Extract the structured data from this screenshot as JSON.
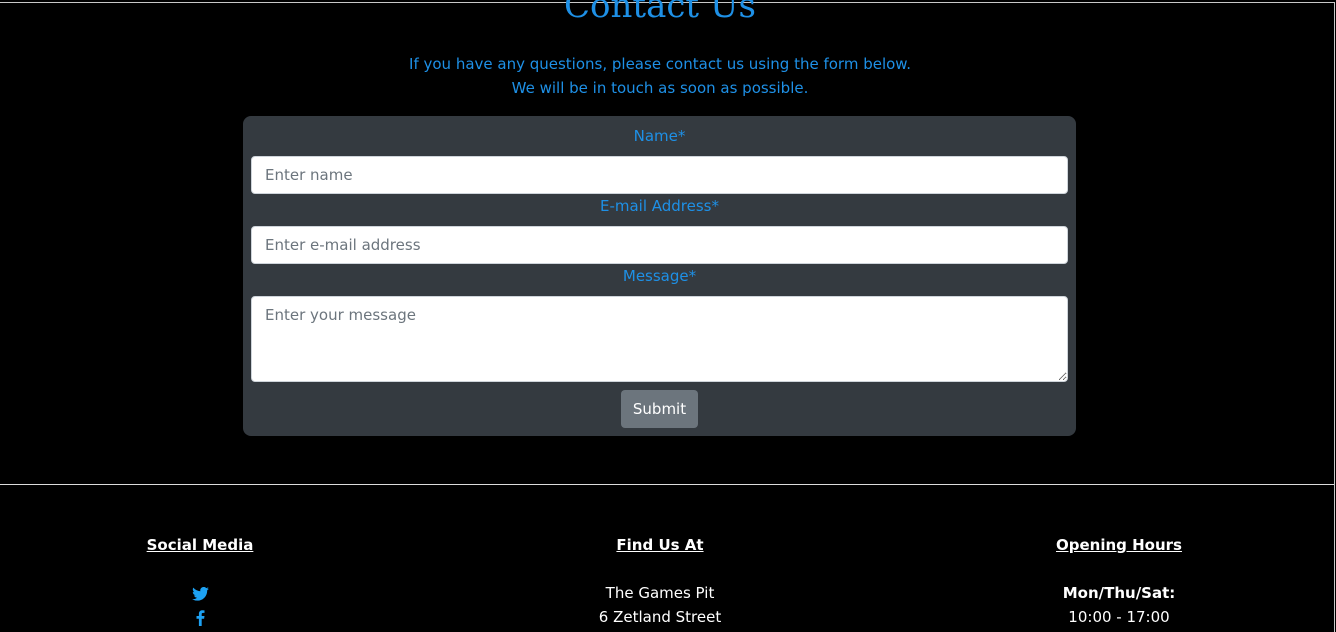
{
  "contact": {
    "title": "Contact Us",
    "intro_line1": "If you have any questions, please contact us using the form below.",
    "intro_line2": "We will be in touch as soon as possible."
  },
  "form": {
    "name_label": "Name*",
    "name_placeholder": "Enter name",
    "email_label": "E-mail Address*",
    "email_placeholder": "Enter e-mail address",
    "message_label": "Message*",
    "message_placeholder": "Enter your message",
    "submit_label": "Submit"
  },
  "footer": {
    "social": {
      "heading": "Social Media",
      "icons": [
        "twitter-icon",
        "facebook-icon"
      ]
    },
    "find_us": {
      "heading": "Find Us At",
      "line1": "The Games Pit",
      "line2": "6 Zetland Street"
    },
    "hours": {
      "heading": "Opening Hours",
      "days": "Mon/Thu/Sat:",
      "times": "10:00 - 17:00"
    }
  },
  "colors": {
    "accent": "#1e90e6",
    "card": "#343a40",
    "button": "#6c757d",
    "icon": "#1da1f2"
  }
}
